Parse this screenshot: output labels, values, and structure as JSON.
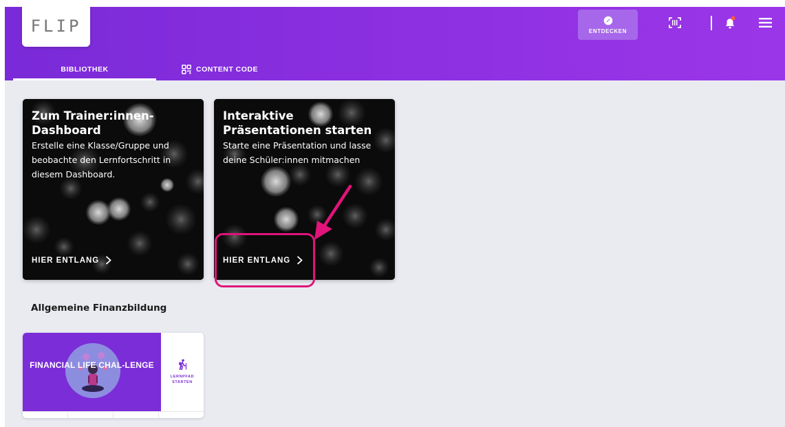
{
  "header": {
    "logo_text": "FLIP",
    "explore_label": "ENTDECKEN",
    "icons": [
      "compass-icon",
      "barcode-scan-icon",
      "bell-icon",
      "menu-icon"
    ]
  },
  "tabs": [
    {
      "label": "BIBLIOTHEK",
      "active": true
    },
    {
      "label": "CONTENT CODE",
      "active": false,
      "icon": "qr-code-icon"
    }
  ],
  "cards": [
    {
      "title": "Zum Trainer:innen-Dashboard",
      "description": "Erstelle eine Klasse/Gruppe und beobachte den Lernfortschritt in diesem Dashboard.",
      "link_label": "HIER ENTLANG"
    },
    {
      "title": "Interaktive Präsentationen starten",
      "description": "Starte eine Präsentation und lasse deine Schüler:innen mitmachen",
      "link_label": "HIER ENTLANG"
    }
  ],
  "section": {
    "title": "Allgemeine Finanzbildung"
  },
  "course": {
    "title": "FINANCIAL LIFE CHAL-LENGE",
    "action_label": "LERNPFAD STARTEN",
    "action_icon": "hiking-icon"
  },
  "colors": {
    "primary": "#7b2dd8",
    "primary_light": "#a767ea",
    "highlight": "#e0147a",
    "background": "#e9ebf1",
    "notification_dot": "#ff5a3c"
  }
}
